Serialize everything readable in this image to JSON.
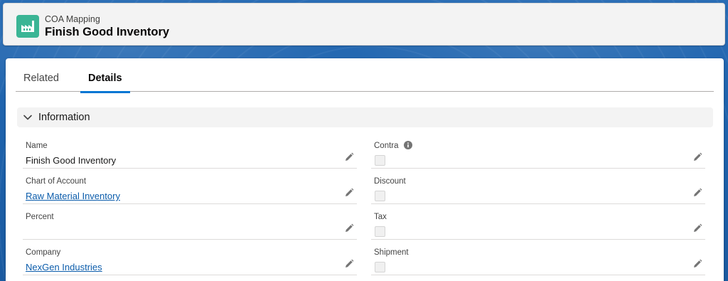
{
  "header": {
    "object_label": "COA Mapping",
    "record_title": "Finish Good Inventory",
    "icon": "factory-icon"
  },
  "tabs": [
    {
      "label": "Related",
      "active": false
    },
    {
      "label": "Details",
      "active": true
    }
  ],
  "section": {
    "title": "Information",
    "expanded": true
  },
  "fields_left": [
    {
      "label": "Name",
      "value": "Finish Good Inventory",
      "is_link": false
    },
    {
      "label": "Chart of Account",
      "value": "Raw Material Inventory",
      "is_link": true
    },
    {
      "label": "Percent",
      "value": "",
      "is_link": false
    },
    {
      "label": "Company",
      "value": "NexGen Industries",
      "is_link": true
    }
  ],
  "fields_right": [
    {
      "label": "Contra",
      "checked": false,
      "has_info": true
    },
    {
      "label": "Discount",
      "checked": false,
      "has_info": false
    },
    {
      "label": "Tax",
      "checked": false,
      "has_info": false
    },
    {
      "label": "Shipment",
      "checked": false,
      "has_info": false
    }
  ],
  "colors": {
    "brand_blue": "#0176d3",
    "link": "#0b5cab",
    "icon_green": "#3bb595"
  }
}
